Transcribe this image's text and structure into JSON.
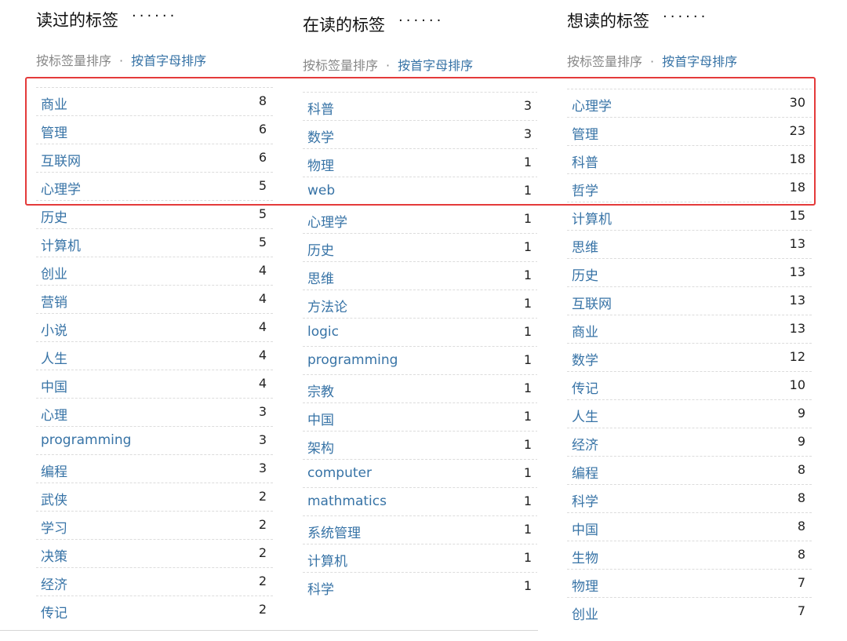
{
  "sort": {
    "by_count": "按标签量排序",
    "separator": "·",
    "by_alpha": "按首字母排序"
  },
  "columns": [
    {
      "title": "读过的标签",
      "dots": "······",
      "tags": [
        {
          "name": "商业",
          "count": "8"
        },
        {
          "name": "管理",
          "count": "6"
        },
        {
          "name": "互联网",
          "count": "6"
        },
        {
          "name": "心理学",
          "count": "5"
        },
        {
          "name": "历史",
          "count": "5"
        },
        {
          "name": "计算机",
          "count": "5"
        },
        {
          "name": "创业",
          "count": "4"
        },
        {
          "name": "营销",
          "count": "4"
        },
        {
          "name": "小说",
          "count": "4"
        },
        {
          "name": "人生",
          "count": "4"
        },
        {
          "name": "中国",
          "count": "4"
        },
        {
          "name": "心理",
          "count": "3"
        },
        {
          "name": "programming",
          "count": "3"
        },
        {
          "name": "编程",
          "count": "3"
        },
        {
          "name": "武侠",
          "count": "2"
        },
        {
          "name": "学习",
          "count": "2"
        },
        {
          "name": "决策",
          "count": "2"
        },
        {
          "name": "经济",
          "count": "2"
        },
        {
          "name": "传记",
          "count": "2"
        }
      ]
    },
    {
      "title": "在读的标签",
      "dots": "······",
      "tags": [
        {
          "name": "科普",
          "count": "3"
        },
        {
          "name": "数学",
          "count": "3"
        },
        {
          "name": "物理",
          "count": "1"
        },
        {
          "name": "web",
          "count": "1"
        },
        {
          "name": "心理学",
          "count": "1"
        },
        {
          "name": "历史",
          "count": "1"
        },
        {
          "name": "思维",
          "count": "1"
        },
        {
          "name": "方法论",
          "count": "1"
        },
        {
          "name": "logic",
          "count": "1"
        },
        {
          "name": "programming",
          "count": "1"
        },
        {
          "name": "宗教",
          "count": "1"
        },
        {
          "name": "中国",
          "count": "1"
        },
        {
          "name": "架构",
          "count": "1"
        },
        {
          "name": "computer",
          "count": "1"
        },
        {
          "name": "mathmatics",
          "count": "1"
        },
        {
          "name": "系统管理",
          "count": "1"
        },
        {
          "name": "计算机",
          "count": "1"
        },
        {
          "name": "科学",
          "count": "1"
        }
      ]
    },
    {
      "title": "想读的标签",
      "dots": "······",
      "tags": [
        {
          "name": "心理学",
          "count": "30"
        },
        {
          "name": "管理",
          "count": "23"
        },
        {
          "name": "科普",
          "count": "18"
        },
        {
          "name": "哲学",
          "count": "18"
        },
        {
          "name": "计算机",
          "count": "15"
        },
        {
          "name": "思维",
          "count": "13"
        },
        {
          "name": "历史",
          "count": "13"
        },
        {
          "name": "互联网",
          "count": "13"
        },
        {
          "name": "商业",
          "count": "13"
        },
        {
          "name": "数学",
          "count": "12"
        },
        {
          "name": "传记",
          "count": "10"
        },
        {
          "name": "人生",
          "count": "9"
        },
        {
          "name": "经济",
          "count": "9"
        },
        {
          "name": "编程",
          "count": "8"
        },
        {
          "name": "科学",
          "count": "8"
        },
        {
          "name": "中国",
          "count": "8"
        },
        {
          "name": "生物",
          "count": "8"
        },
        {
          "name": "物理",
          "count": "7"
        },
        {
          "name": "创业",
          "count": "7"
        }
      ]
    }
  ]
}
